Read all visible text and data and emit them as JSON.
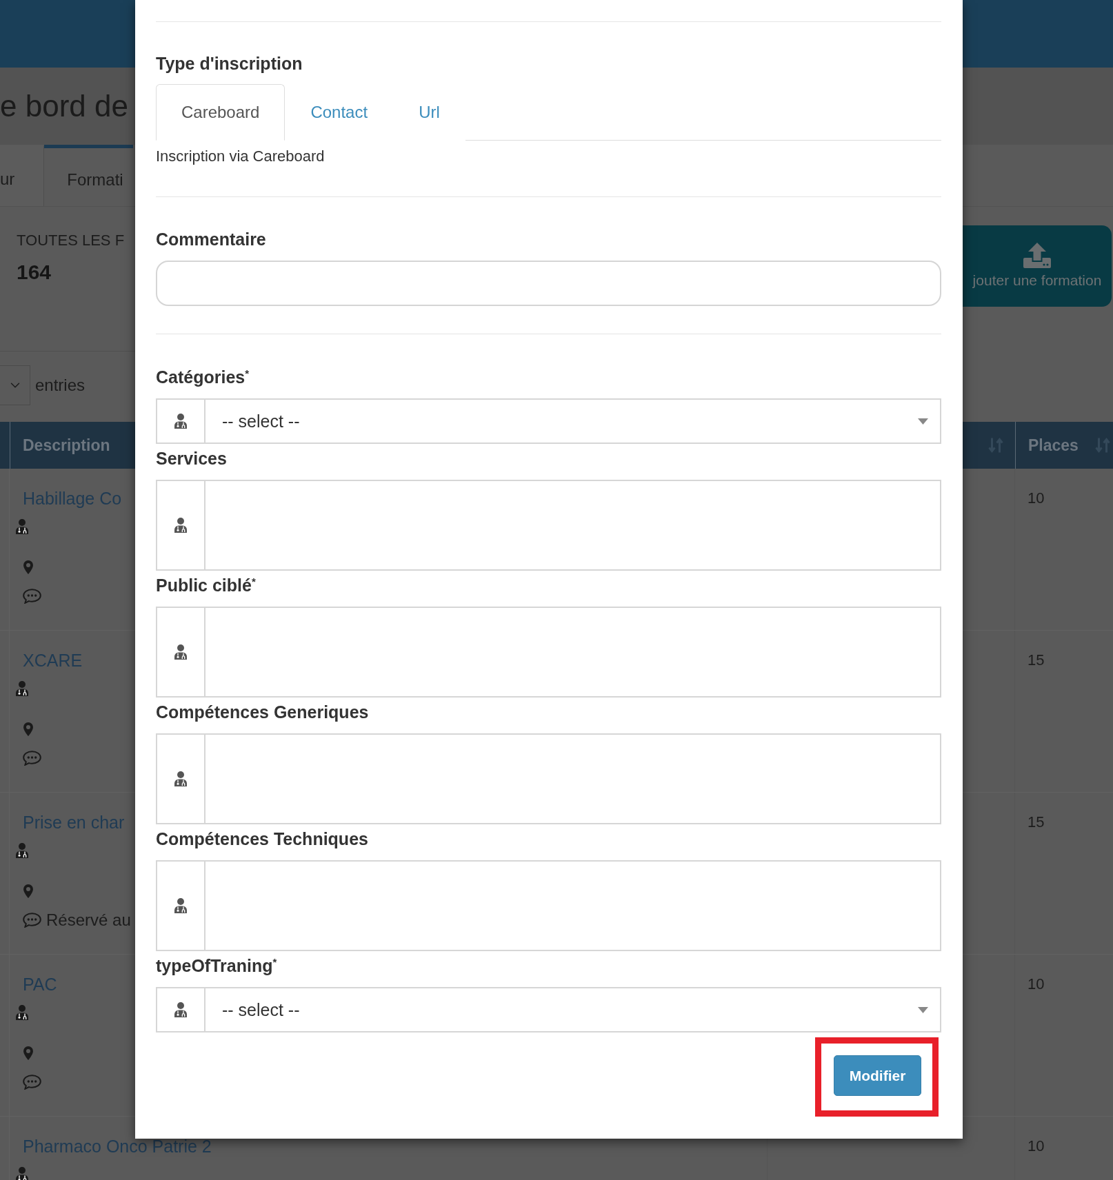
{
  "page": {
    "title": "e bord de",
    "tabs": [
      {
        "label": "ur",
        "selected": false
      },
      {
        "label": "Formati",
        "selected": true
      }
    ],
    "stats": {
      "label": "TOUTES LES F",
      "value": "164"
    },
    "add_button": {
      "label": "jouter une formation"
    },
    "length_label": "entries"
  },
  "table": {
    "columns": [
      {
        "label": "Description",
        "sortable": false
      },
      {
        "sortable": true
      },
      {
        "label": "Places",
        "sortable": true
      }
    ],
    "rows": [
      {
        "title": "Habillage Co",
        "places": "10",
        "details": [
          {
            "kind": "doctor"
          },
          {
            "kind": "location"
          },
          {
            "kind": "comment"
          }
        ]
      },
      {
        "title": "XCARE",
        "places": "15",
        "details": [
          {
            "kind": "doctor"
          },
          {
            "kind": "location"
          },
          {
            "kind": "comment"
          }
        ]
      },
      {
        "title": "Prise en char",
        "places": "15",
        "details": [
          {
            "kind": "doctor"
          },
          {
            "kind": "location"
          },
          {
            "kind": "comment",
            "text": "Réservé au"
          }
        ]
      },
      {
        "title": "PAC",
        "places": "10",
        "details": [
          {
            "kind": "doctor"
          },
          {
            "kind": "location"
          },
          {
            "kind": "comment"
          }
        ]
      },
      {
        "title": "Pharmaco Onco Patrie 2",
        "places": "10",
        "details": [
          {
            "kind": "doctor"
          }
        ]
      }
    ]
  },
  "dialog": {
    "registration": {
      "heading": "Type d'inscription",
      "tabs": [
        {
          "label": "Careboard",
          "selected": true
        },
        {
          "label": "Contact",
          "selected": false
        },
        {
          "label": "Url",
          "selected": false
        }
      ],
      "help": "Inscription via Careboard"
    },
    "comment": {
      "label": "Commentaire"
    },
    "fields": [
      {
        "label": "Catégories$^{*}$",
        "kind": "select",
        "value": "-- select --"
      },
      {
        "label": "Services",
        "kind": "multiselect"
      },
      {
        "label": "Public ciblé$^{*}$",
        "kind": "multiselect"
      },
      {
        "label": "Compétences Generiques",
        "kind": "multiselect"
      },
      {
        "label": "Compétences Techniques",
        "kind": "multiselect"
      },
      {
        "label": "typeOfTraning$^{*}$",
        "kind": "select",
        "value": "-- select --"
      }
    ],
    "submit": {
      "label": "Modifier",
      "highlighted": true
    }
  }
}
